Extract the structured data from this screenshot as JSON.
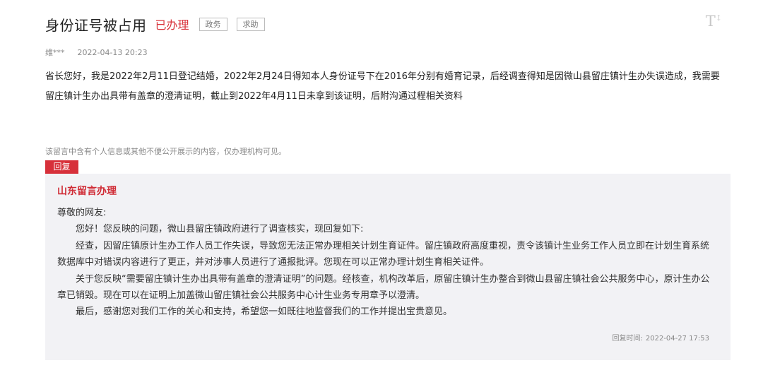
{
  "header": {
    "title": "身份证号被占用",
    "status": "已办理",
    "tags": [
      "政务",
      "求助"
    ],
    "font_toggle": "T",
    "font_toggle_mark": "↕"
  },
  "meta": {
    "author": "维***",
    "date": "2022-04-13 20:23"
  },
  "message": {
    "body": "省长您好，我是2022年2月11日登记结婚，2022年2月24日得知本人身份证号下在2016年分别有婚育记录，后经调查得知是因微山县留庄镇计生办失误造成，我需要留庄镇计生办出具带有盖章的澄清证明，截止到2022年4月11日未拿到该证明，后附沟通过程相关资料",
    "privacy_note": "该留言中含有个人信息或其他不便公开展示的内容，仅办理机构可见。"
  },
  "reply": {
    "badge": "回复",
    "org": "山东留言办理",
    "paragraphs": [
      "尊敬的网友:",
      "您好！您反映的问题，微山县留庄镇政府进行了调查核实，现回复如下:",
      "经查，因留庄镇原计生办工作人员工作失误，导致您无法正常办理相关计划生育证件。留庄镇政府高度重视，责令该镇计生业务工作人员立即在计划生育系统数据库中对错误内容进行了更正，并对涉事人员进行了通报批评。您现在可以正常办理计划生育相关证件。",
      "关于您反映“需要留庄镇计生办出具带有盖章的澄清证明”的问题。经核查，机构改革后，原留庄镇计生办整合到微山县留庄镇社会公共服务中心，原计生办公章已销毁。现在可以在证明上加盖微山留庄镇社会公共服务中心计生业务专用章予以澄清。",
      "最后，感谢您对我们工作的关心和支持，希望您一如既往地监督我们的工作并提出宝贵意见。"
    ],
    "time_label": "回复时间:",
    "time_value": "2022-04-27 17:53"
  },
  "colors": {
    "accent_red": "#d7303a",
    "panel_bg": "#f2f2f5"
  }
}
